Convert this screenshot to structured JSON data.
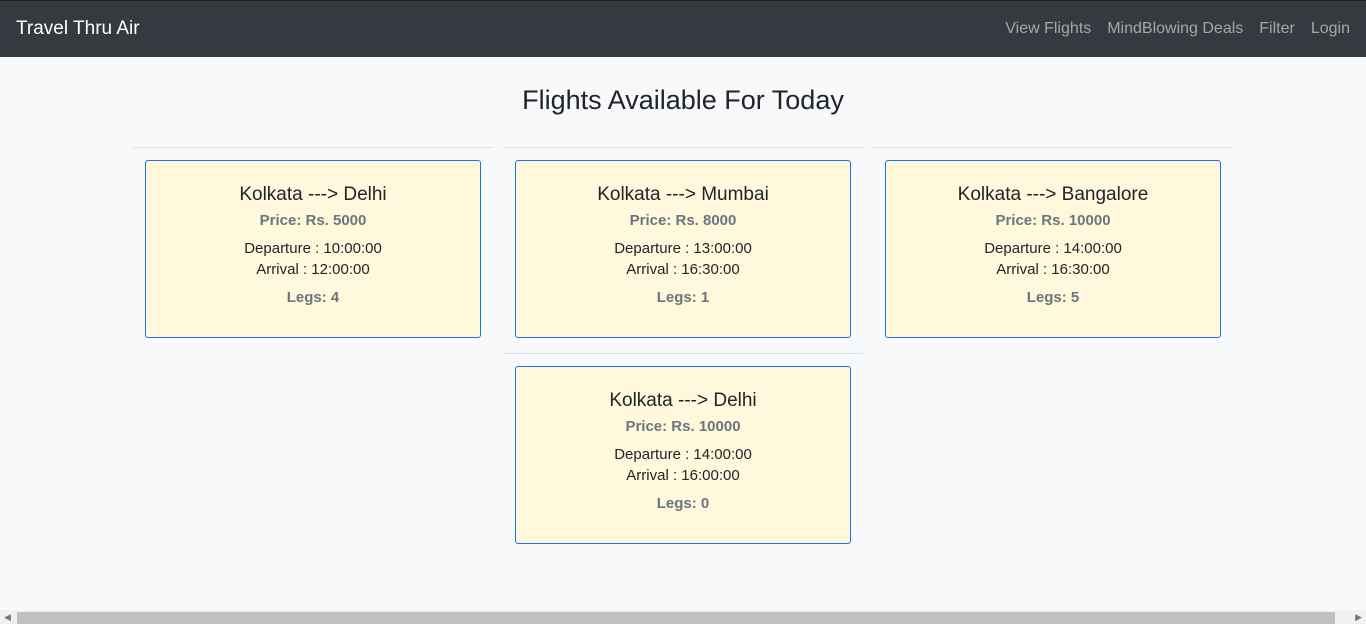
{
  "navbar": {
    "brand": "Travel Thru Air",
    "links": [
      "View Flights",
      "MindBlowing Deals",
      "Filter",
      "Login"
    ]
  },
  "page_title": "Flights Available For Today",
  "flights": [
    {
      "route": "Kolkata ---> Delhi",
      "price": "Price: Rs. 5000",
      "departure": "Departure : 10:00:00",
      "arrival": "Arrival : 12:00:00",
      "legs": "Legs: 4"
    },
    {
      "route": "Kolkata ---> Mumbai",
      "price": "Price: Rs. 8000",
      "departure": "Departure : 13:00:00",
      "arrival": "Arrival : 16:30:00",
      "legs": "Legs: 1"
    },
    {
      "route": "Kolkata ---> Bangalore",
      "price": "Price: Rs. 10000",
      "departure": "Departure : 14:00:00",
      "arrival": "Arrival : 16:30:00",
      "legs": "Legs: 5"
    },
    {
      "route": "Kolkata ---> Delhi",
      "price": "Price: Rs. 10000",
      "departure": "Departure : 14:00:00",
      "arrival": "Arrival : 16:00:00",
      "legs": "Legs: 0"
    }
  ]
}
